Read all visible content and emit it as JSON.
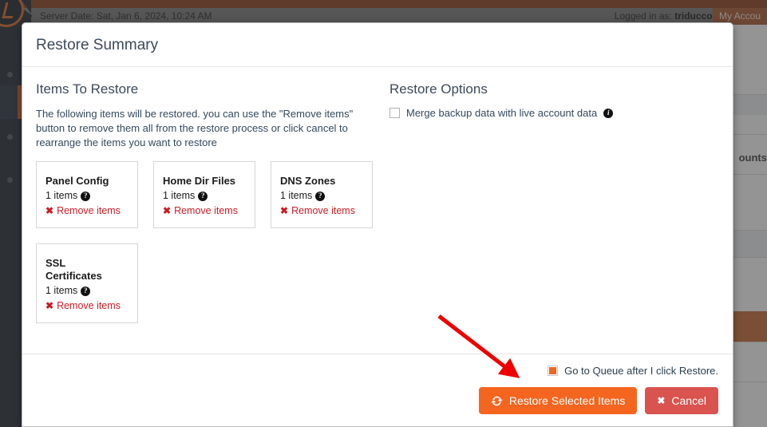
{
  "topbar": {
    "server_date": "Server Date: Sat, Jan 6, 2024, 10:24 AM",
    "logged_in_prefix": "Logged in as: ",
    "username": "triducco",
    "separator": " |",
    "my_account_label": "My Accou"
  },
  "background": {
    "accounts_label": "ounts"
  },
  "modal": {
    "title": "Restore Summary",
    "left": {
      "heading": "Items To Restore",
      "description": "The following items will be restored. you can use the \"Remove items\" button to remove them all from the restore process or click cancel to rearrange the items you want to restore",
      "cards": [
        {
          "name": "Panel Config",
          "count": "1 items",
          "help_icon": "question-mark-circle-icon",
          "remove_label": "Remove items",
          "remove_icon": "x-mark-icon"
        },
        {
          "name": "Home Dir Files",
          "count": "1 items",
          "help_icon": "question-mark-circle-icon",
          "remove_label": "Remove items",
          "remove_icon": "x-mark-icon"
        },
        {
          "name": "DNS Zones",
          "count": "1 items",
          "help_icon": "question-mark-circle-icon",
          "remove_label": "Remove items",
          "remove_icon": "x-mark-icon"
        },
        {
          "name": "SSL Certificates",
          "count": "1 items",
          "help_icon": "question-mark-circle-icon",
          "remove_label": "Remove items",
          "remove_icon": "x-mark-icon"
        }
      ]
    },
    "right": {
      "heading": "Restore Options",
      "merge_option": {
        "label": "Merge backup data with live account data",
        "checked": false,
        "info_icon": "info-circle-icon"
      }
    },
    "footer": {
      "queue_option": {
        "label": "Go to Queue after I click Restore.",
        "checked": true
      },
      "restore_button": {
        "label": "Restore Selected Items",
        "icon": "sync-refresh-icon"
      },
      "cancel_button": {
        "label": "Cancel",
        "icon": "x-mark-icon"
      }
    }
  },
  "colors": {
    "accent_orange": "#f4651f",
    "danger_red": "#d9534f",
    "remove_red": "#cf1b23",
    "title_slate": "#3d4a5c",
    "annotation_red": "#ee0000"
  },
  "annotation": {
    "arrow_name": "red-pointer-arrow"
  }
}
